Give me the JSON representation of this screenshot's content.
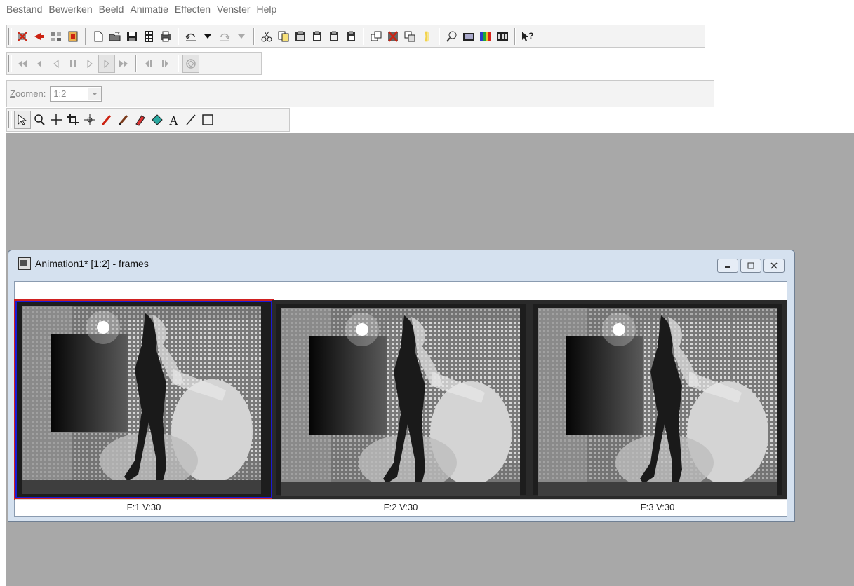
{
  "menu": [
    "Bestand",
    "Bewerken",
    "Beeld",
    "Animatie",
    "Effecten",
    "Venster",
    "Help"
  ],
  "toolbar_main": {
    "groups": [
      [
        "wizard-icon",
        "arrow-red-icon",
        "layers-icon",
        "export-icon"
      ],
      [
        "new-file-icon",
        "open-folder-icon",
        "save-icon",
        "film-icon",
        "print-icon"
      ],
      [
        "undo-icon",
        "undo-dropdown-icon",
        "redo-icon",
        "redo-dropdown-icon"
      ],
      [
        "cut-icon",
        "copy-icon",
        "paste-new-icon",
        "paste-before-icon",
        "paste-after-icon",
        "paste-into-icon"
      ],
      [
        "duplicate-icon",
        "delete-frame-icon",
        "transition-icon",
        "banner-icon"
      ],
      [
        "preview-icon",
        "frame-properties-icon",
        "palette-icon",
        "film-strip-icon"
      ],
      [
        "help-icon"
      ]
    ]
  },
  "toolbar_animation": {
    "buttons": [
      "first-frame-icon",
      "previous-frame-icon",
      "step-back-icon",
      "pause-icon",
      "play-icon",
      "play-active-icon",
      "fast-forward-icon",
      "step-previous-icon",
      "step-next-icon",
      "loop-icon"
    ]
  },
  "zoom": {
    "label_accel": "Z",
    "label_rest": "oomen:",
    "value": "1:2"
  },
  "toolbar_tools": [
    "select-arrow-icon",
    "zoom-icon",
    "crosshair-icon",
    "crop-icon",
    "move-icon",
    "dropper-icon",
    "brush-icon",
    "eraser-icon",
    "fill-icon",
    "text-icon",
    "line-icon",
    "rectangle-icon"
  ],
  "window": {
    "title": "Animation1* [1:2] - frames",
    "frames": [
      {
        "label": "F:1  V:30",
        "selected": true
      },
      {
        "label": "F:2  V:30",
        "selected": false
      },
      {
        "label": "F:3  V:30",
        "selected": false
      }
    ]
  },
  "colors": {
    "workspace": "#a8a8a8",
    "selection_blue": "#1b1bd3",
    "selection_red": "#d02020"
  }
}
